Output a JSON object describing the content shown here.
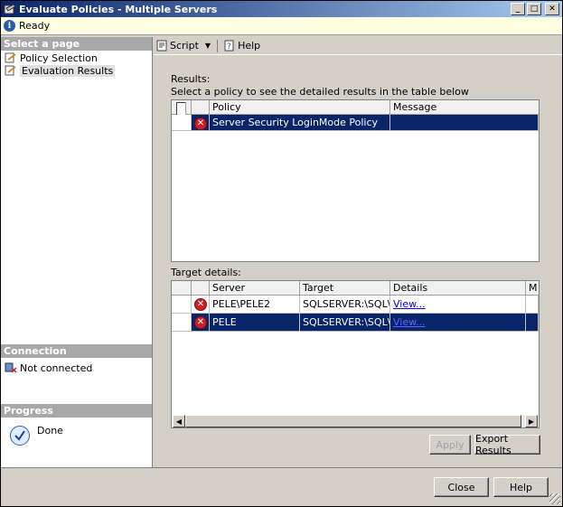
{
  "window": {
    "title": "Evaluate Policies - Multiple Servers"
  },
  "status": {
    "text": "Ready"
  },
  "left": {
    "select_page": "Select a page",
    "pages": [
      {
        "label": "Policy Selection"
      },
      {
        "label": "Evaluation Results"
      }
    ],
    "connection_header": "Connection",
    "connection_status": "Not connected",
    "progress_header": "Progress",
    "progress_status": "Done"
  },
  "toolbar": {
    "script_label": "Script",
    "help_label": "Help"
  },
  "results": {
    "label": "Results:",
    "hint": "Select a policy to see the detailed results in the table below",
    "columns": [
      "Policy",
      "Message"
    ],
    "rows": [
      {
        "policy": "Server Security LoginMode Policy",
        "message": ""
      }
    ]
  },
  "target": {
    "label": "Target details:",
    "columns": [
      "Server",
      "Target",
      "Details",
      "M"
    ],
    "rows": [
      {
        "server": "PELE\\PELE2",
        "target": "SQLSERVER:\\SQL\\P...",
        "details": "View..."
      },
      {
        "server": "PELE",
        "target": "SQLSERVER:\\SQL\\P...",
        "details": "View..."
      }
    ]
  },
  "buttons": {
    "apply": "Apply",
    "export": "Export Results",
    "close": "Close",
    "help": "Help"
  }
}
